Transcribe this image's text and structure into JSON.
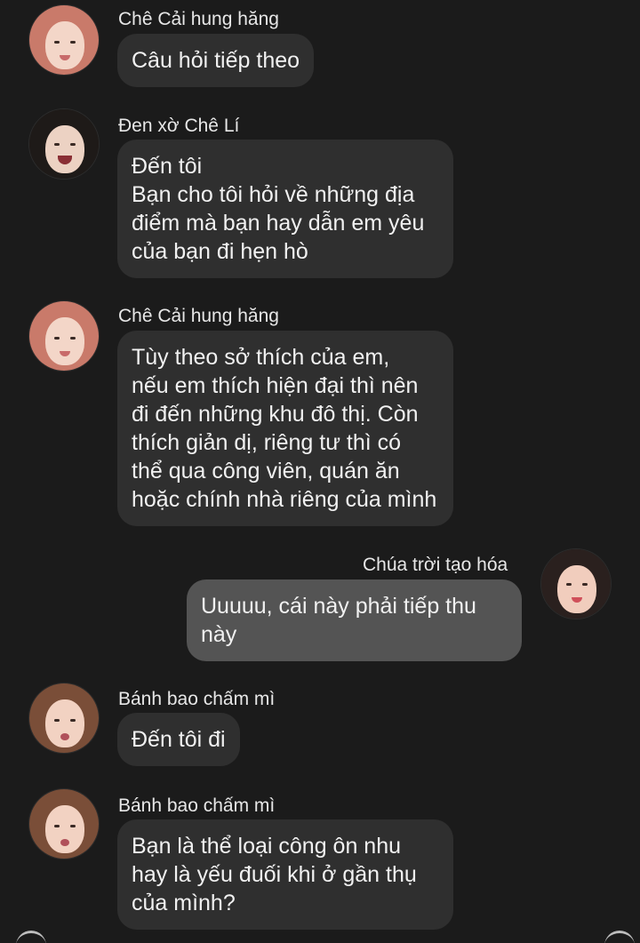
{
  "messages": [
    {
      "sender": "Chê Cải hung hăng",
      "lines": [
        "Câu hỏi tiếp theo"
      ]
    },
    {
      "sender": "Đen xờ Chê Lí",
      "lines": [
        "Đến tôi",
        "Bạn cho tôi hỏi về những địa",
        "điểm mà bạn hay dẫn em yêu",
        "của bạn đi hẹn hò"
      ]
    },
    {
      "sender": "Chê Cải hung hăng",
      "lines": [
        "Tùy theo sở thích của em,",
        "nếu em thích hiện đại thì nên",
        "đi đến những khu đô thị. Còn",
        "thích giản dị, riêng tư thì có",
        "thể qua công viên, quán ăn",
        "hoặc chính nhà riêng của mình"
      ]
    },
    {
      "sender": "Chúa trời tạo hóa",
      "lines": [
        "Uuuuu, cái này phải tiếp thu",
        "này"
      ]
    },
    {
      "sender": "Bánh bao chấm mì",
      "lines": [
        "Đến tôi đi"
      ]
    },
    {
      "sender": "Bánh bao chấm mì",
      "lines": [
        "Bạn là thể loại công ôn nhu",
        "hay là yếu đuối khi ở gần thụ",
        "của mình?"
      ]
    }
  ],
  "colors": {
    "background": "#1b1b1b",
    "bubble_incoming": "#2f2f2f",
    "bubble_outgoing": "#545454",
    "text": "#f1f1f1",
    "name_text": "#e7e7e7"
  }
}
